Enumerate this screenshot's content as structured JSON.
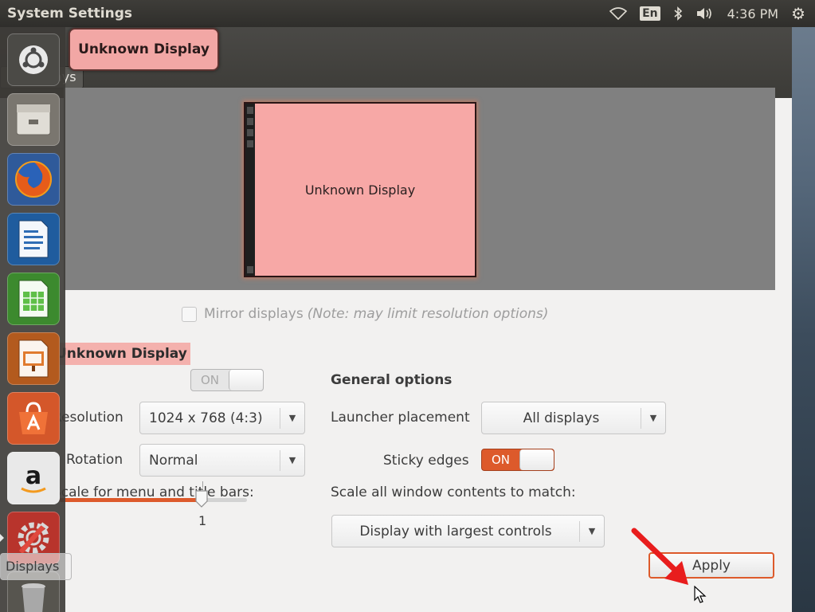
{
  "panel": {
    "title": "System Settings",
    "keyboard_layout": "En",
    "clock": "4:36 PM",
    "icons": [
      "wifi-icon",
      "keyboard-layout-icon",
      "bluetooth-icon",
      "volume-icon",
      "system-gear-icon"
    ]
  },
  "header": {
    "breadcrumb_prefix": "...",
    "breadcrumb": "Displays"
  },
  "tooltip": "Unknown Display",
  "arrangement": {
    "display_label": "Unknown Display"
  },
  "mirror": {
    "label": "Mirror displays",
    "note": "(Note: may limit resolution options)",
    "checked": false
  },
  "display_settings": {
    "display_name": "Unknown Display",
    "power_state": "ON",
    "resolution_label": "Resolution",
    "resolution_value": "1024 x 768 (4:3)",
    "rotation_label": "Rotation",
    "rotation_value": "Normal",
    "scale_label": "Scale for menu and title bars:",
    "scale_value": "1",
    "scale_fraction": 0.76
  },
  "general_options": {
    "heading": "General options",
    "launcher_label": "Launcher placement",
    "launcher_value": "All displays",
    "sticky_label": "Sticky edges",
    "sticky_state": "ON",
    "scale_all_label": "Scale all window contents to match:",
    "scale_all_value": "Display with largest controls"
  },
  "buttons": {
    "apply": "Apply"
  },
  "launcher": {
    "items": [
      {
        "name": "dash-icon"
      },
      {
        "name": "files-icon"
      },
      {
        "name": "firefox-icon"
      },
      {
        "name": "writer-icon"
      },
      {
        "name": "calc-icon"
      },
      {
        "name": "impress-icon"
      },
      {
        "name": "software-center-icon"
      },
      {
        "name": "amazon-icon"
      },
      {
        "name": "system-settings-icon"
      },
      {
        "name": "trash-icon"
      }
    ],
    "bottom_chip": "Displays"
  },
  "colors": {
    "accent": "#dd5a2b",
    "display_highlight": "#f7a8a6",
    "arrow": "#e81d1d"
  }
}
